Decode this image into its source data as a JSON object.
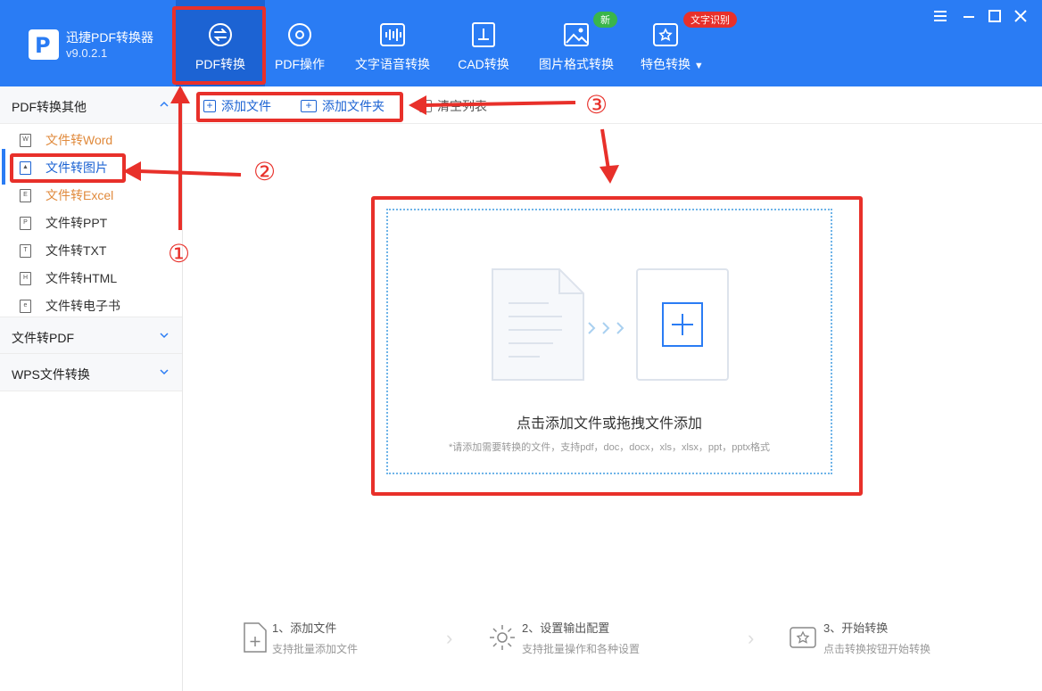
{
  "app": {
    "name": "迅捷PDF转换器",
    "version": "v9.0.2.1"
  },
  "tabs": [
    {
      "label": "PDF转换"
    },
    {
      "label": "PDF操作"
    },
    {
      "label": "文字语音转换"
    },
    {
      "label": "CAD转换"
    },
    {
      "label": "图片格式转换",
      "badge": "新"
    },
    {
      "label": "特色转换",
      "badge": "文字识别"
    }
  ],
  "sidebar": {
    "sections": [
      {
        "label": "PDF转换其他",
        "expanded": true
      },
      {
        "label": "文件转PDF",
        "expanded": false
      },
      {
        "label": "WPS文件转换",
        "expanded": false
      }
    ],
    "items": [
      {
        "label": "文件转Word",
        "icon": "W"
      },
      {
        "label": "文件转图片",
        "icon": "img"
      },
      {
        "label": "文件转Excel",
        "icon": "E"
      },
      {
        "label": "文件转PPT",
        "icon": "P"
      },
      {
        "label": "文件转TXT",
        "icon": "T"
      },
      {
        "label": "文件转HTML",
        "icon": "H"
      },
      {
        "label": "文件转电子书",
        "icon": "e"
      }
    ]
  },
  "toolbar": {
    "add_file": "添加文件",
    "add_folder": "添加文件夹",
    "clear": "清空列表"
  },
  "dropzone": {
    "title": "点击添加文件或拖拽文件添加",
    "hint": "*请添加需要转换的文件，支持pdf，doc，docx，xls，xlsx，ppt，pptx格式"
  },
  "steps": [
    {
      "title": "1、添加文件",
      "sub": "支持批量添加文件"
    },
    {
      "title": "2、设置输出配置",
      "sub": "支持批量操作和各种设置"
    },
    {
      "title": "3、开始转换",
      "sub": "点击转换按钮开始转换"
    }
  ],
  "annotations": [
    "①",
    "②",
    "③"
  ],
  "colors": {
    "brand": "#2a7cf4",
    "accent_red": "#e8302a",
    "active_tab": "#1c63d3"
  }
}
